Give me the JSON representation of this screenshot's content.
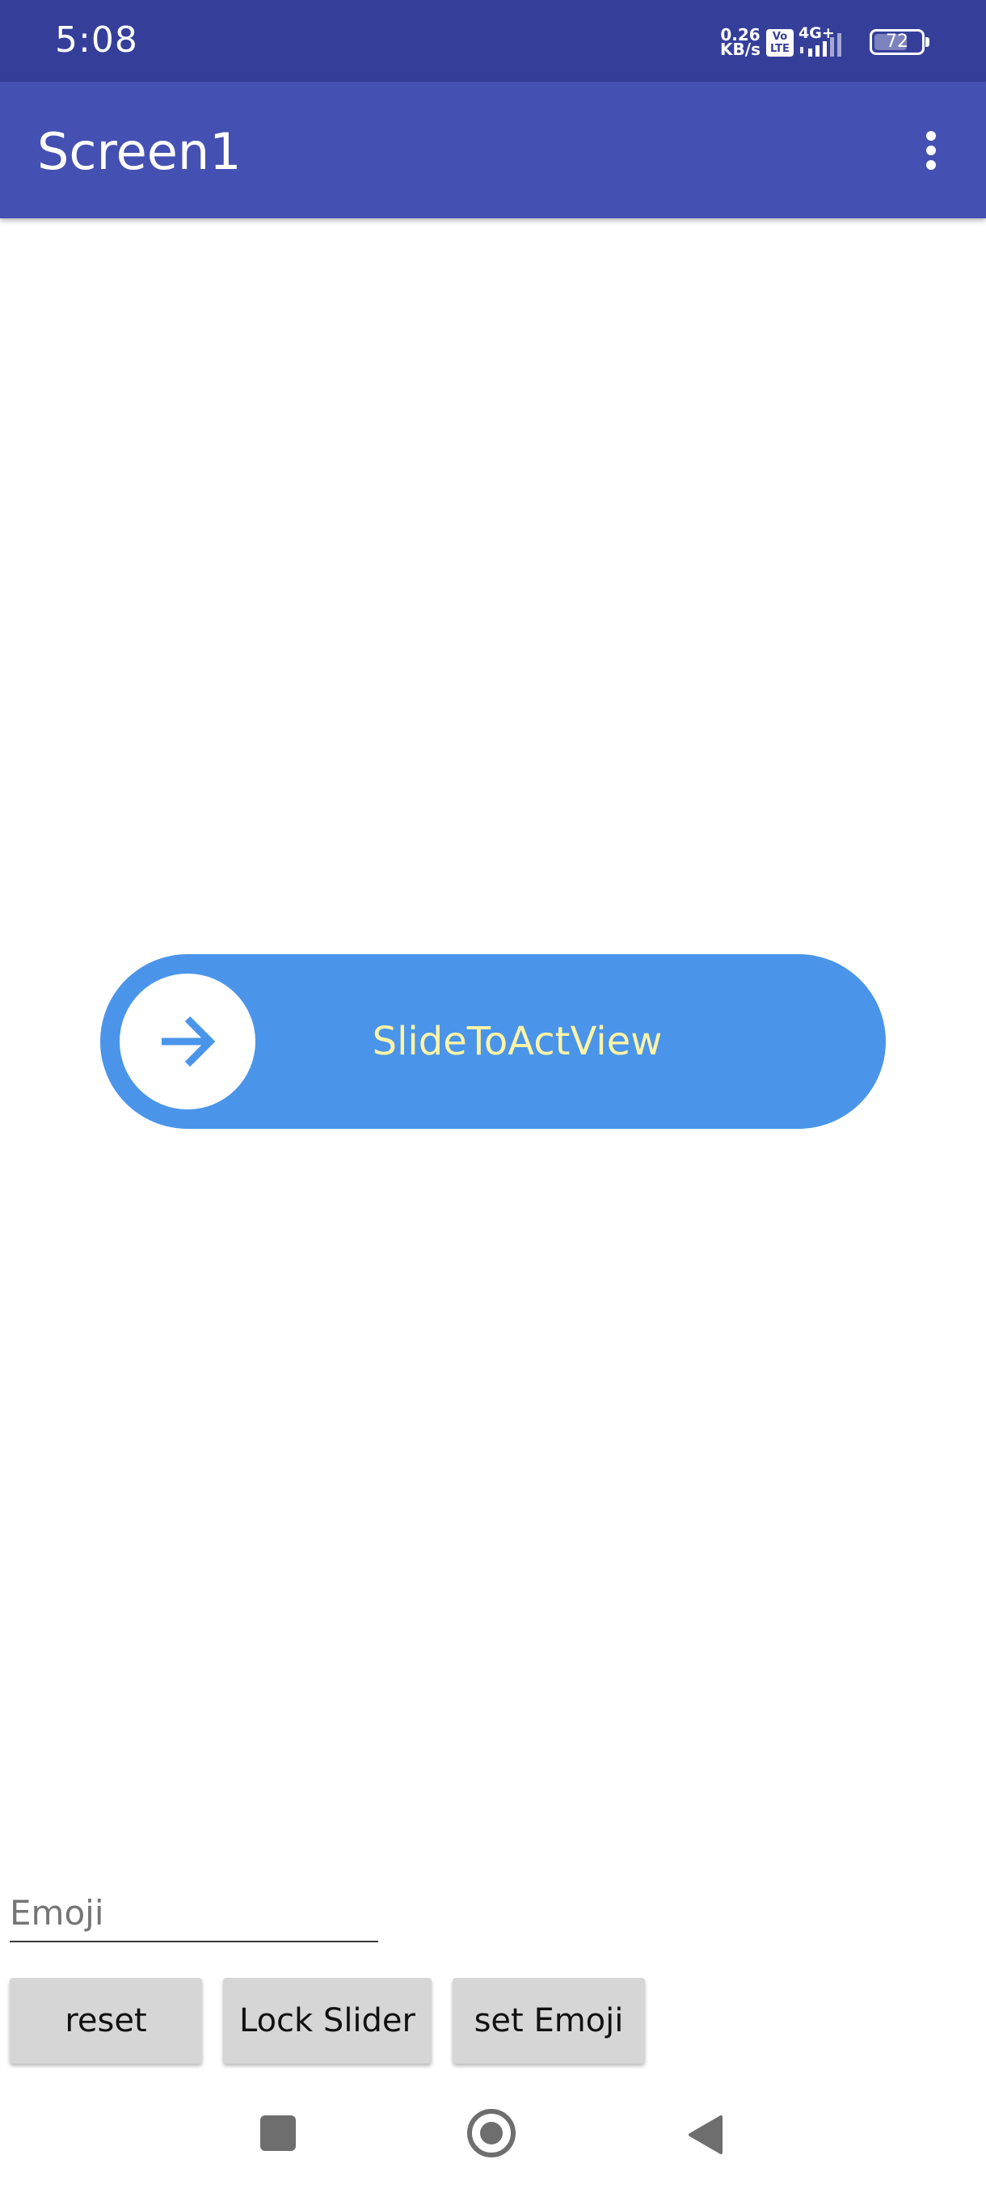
{
  "status_bar": {
    "time": "5:08",
    "net_speed_value": "0.26",
    "net_speed_unit": "KB/s",
    "volte_line1": "Vo",
    "volte_line2": "LTE",
    "network_type": "4G+",
    "battery": "72",
    "battery_level": 0.72,
    "signal_icon": "signal-icon",
    "battery_icon": "battery-icon"
  },
  "app_bar": {
    "title": "Screen1",
    "menu_icon": "overflow-menu-icon",
    "color": "#4450b2"
  },
  "slider": {
    "label": "SlideToActView",
    "knob_icon": "arrow-right-icon",
    "color": "#4a95e9",
    "text_color": "#fff4a6"
  },
  "emoji_field": {
    "placeholder": "Emoji"
  },
  "buttons": {
    "reset": "reset",
    "lock_slider": "Lock Slider",
    "set_emoji": "set Emoji"
  },
  "nav_bar": {
    "recents_icon": "recents-icon",
    "home_icon": "home-icon",
    "back_icon": "back-icon"
  }
}
